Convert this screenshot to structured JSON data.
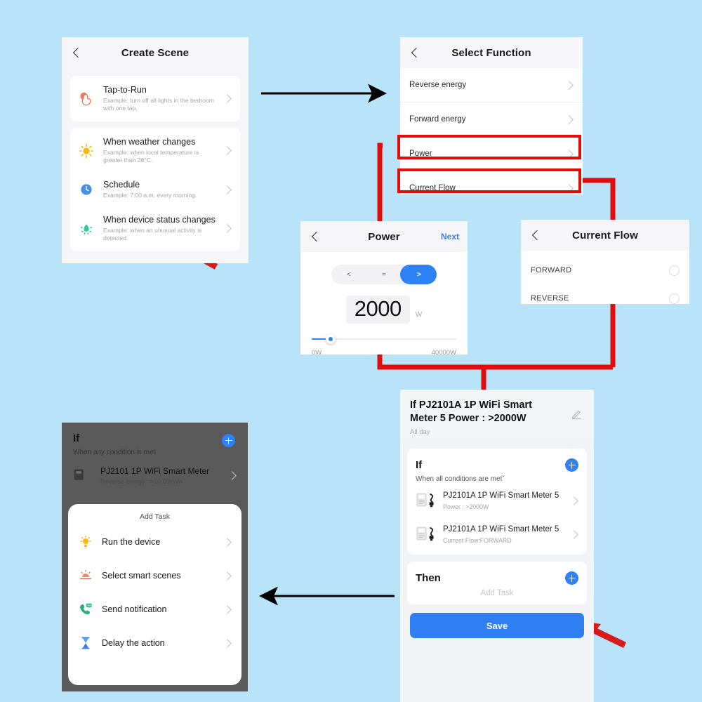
{
  "background_color": "#b9e3f9",
  "accent_blue": "#2f82f5",
  "highlight_red": "#e00d0d",
  "create_scene": {
    "title": "Create Scene",
    "back_icon": "chevron-left-icon",
    "items": [
      {
        "icon": "tap-hand-icon",
        "title": "Tap-to-Run",
        "desc": "Example: turn off all lights in the bedroom with one tap."
      },
      {
        "icon": "sun-icon",
        "title": "When weather changes",
        "desc": "Example: when local temperature is greater than 28°C."
      },
      {
        "icon": "clock-icon",
        "title": "Schedule",
        "desc": "Example: 7:00 a.m. every morning."
      },
      {
        "icon": "motion-sensor-icon",
        "title": "When device status changes",
        "desc": "Example: when an unusual activity is detected."
      }
    ]
  },
  "select_function": {
    "title": "Select Function",
    "back_icon": "chevron-left-icon",
    "items": [
      {
        "label": "Reverse energy",
        "highlighted": false
      },
      {
        "label": "Forward energy",
        "highlighted": false
      },
      {
        "label": "Power",
        "highlighted": true
      },
      {
        "label": "Current Flow",
        "highlighted": true
      }
    ]
  },
  "power": {
    "title": "Power",
    "back_icon": "chevron-left-icon",
    "next_label": "Next",
    "operators": [
      "<",
      "=",
      ">"
    ],
    "selected_operator": ">",
    "value": "2000",
    "unit": "W",
    "slider_min_label": "0W",
    "slider_max_label": "40000W",
    "slider_percent": 10
  },
  "current_flow": {
    "title": "Current Flow",
    "back_icon": "chevron-left-icon",
    "options": [
      {
        "label": "FORWARD",
        "selected": false
      },
      {
        "label": "REVERSE",
        "selected": false
      }
    ]
  },
  "summary": {
    "header_title": "If PJ2101A 1P WiFi Smart Meter  5 Power : >2000W",
    "header_sub": "All day",
    "edit_icon": "pencil-icon",
    "if_label": "If",
    "if_sub": "When all conditions are metˇ",
    "add_icon": "plus-circle-icon",
    "conditions": [
      {
        "icon": "smart-meter-icon",
        "name": "PJ2101A 1P WiFi Smart Meter 5",
        "detail": "Power : >2000W"
      },
      {
        "icon": "smart-meter-icon",
        "name": "PJ2101A 1P WiFi Smart Meter 5",
        "detail": "Current Flow:FORWARD"
      }
    ],
    "then_label": "Then",
    "add_task_label": "Add Task",
    "save_label": "Save"
  },
  "add_task": {
    "dim_if_label": "If",
    "dim_if_sub": "When any condition is met",
    "dim_device_name": "PJ2101 1P WiFi Smart Meter",
    "dim_device_detail": "Reverse energy : >10.00kWh",
    "sheet_title": "Add Task",
    "items": [
      {
        "icon": "bulb-icon",
        "label": "Run the device"
      },
      {
        "icon": "scene-icon",
        "label": "Select smart scenes"
      },
      {
        "icon": "phone-notification-icon",
        "label": "Send notification"
      },
      {
        "icon": "hourglass-icon",
        "label": "Delay the action"
      }
    ]
  }
}
